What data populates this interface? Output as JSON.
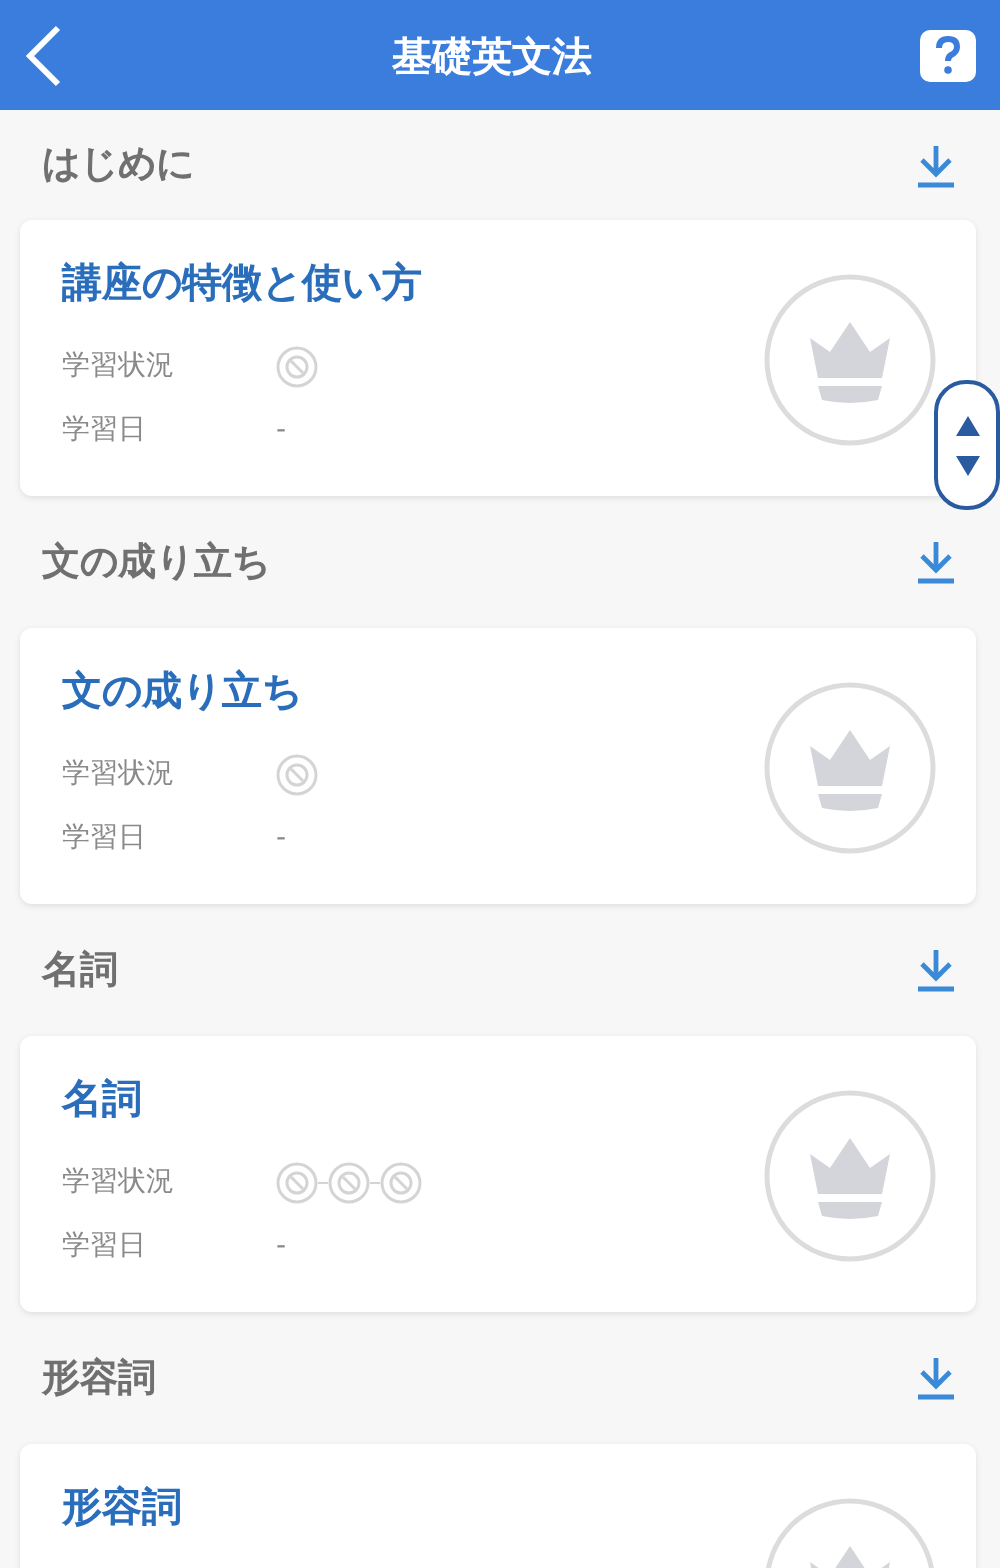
{
  "header": {
    "title": "基礎英文法"
  },
  "sections": [
    {
      "heading": "はじめに",
      "lesson": {
        "title": "講座の特徴と使い方",
        "status_label": "学習状況",
        "status": [
          {
            "kind": "not-started"
          }
        ],
        "date_label": "学習日",
        "date": "-"
      }
    },
    {
      "heading": "文の成り立ち",
      "lesson": {
        "title": "文の成り立ち",
        "status_label": "学習状況",
        "status": [
          {
            "kind": "not-started"
          }
        ],
        "date_label": "学習日",
        "date": "-"
      }
    },
    {
      "heading": "名詞",
      "lesson": {
        "title": "名詞",
        "status_label": "学習状況",
        "status": [
          {
            "kind": "not-started"
          },
          {
            "kind": "not-started"
          },
          {
            "kind": "not-started"
          }
        ],
        "date_label": "学習日",
        "date": "-"
      }
    },
    {
      "heading": "形容詞",
      "lesson": {
        "title": "形容詞"
      }
    }
  ]
}
